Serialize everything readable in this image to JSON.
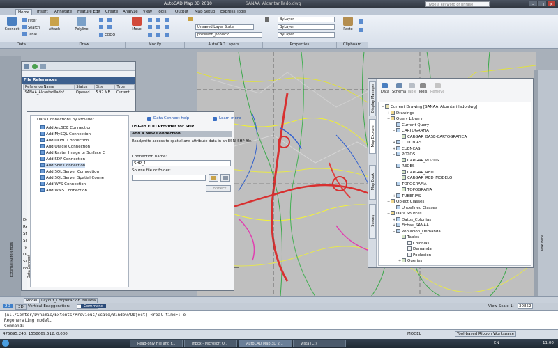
{
  "title_bar": {
    "app_title": "AutoCAD Map 3D 2010",
    "file_title": "SANAA_Alcantarillado.dwg",
    "search_placeholder": "Type a keyword or phrase",
    "min_glyph": "–",
    "max_glyph": "□",
    "close_glyph": "×"
  },
  "ribbon_tabs": [
    "Home",
    "Insert",
    "Annotate",
    "Feature Edit",
    "Create",
    "Analyze",
    "View",
    "Tools",
    "Output",
    "Map Setup",
    "Express Tools"
  ],
  "ribbon": {
    "panels": [
      "Data",
      "Draw",
      "Modify",
      "AutoCAD Layers",
      "Properties",
      "Clipboard"
    ],
    "connect": "Connect",
    "filter": "Filter",
    "search": "Search",
    "table": "Table",
    "attach": "Attach",
    "polyline": "Polyline",
    "cogo": "COGO",
    "move": "Move",
    "layer_state": "Unsaved Layer State",
    "layer_current": "prevision_poblacio",
    "bylayer": "ByLayer",
    "paste": "Paste"
  },
  "file_references": {
    "section_title": "File References",
    "columns": [
      "Reference Name",
      "Status",
      "Size",
      "Type"
    ],
    "rows": [
      {
        "name": "SANAA_Alcantarillado*",
        "status": "Opened",
        "size": "5.92 MB",
        "type": "Current"
      }
    ],
    "side_label": "External References",
    "side_label2": "Data Connect",
    "detail_lines": [
      "De",
      "Re",
      "St",
      "Siz",
      "Ty",
      "Da",
      "Sa",
      "Fo"
    ]
  },
  "data_connect": {
    "by_provider": "Data Connections by Provider",
    "providers": [
      "Add ArcSDE Connection",
      "Add MySQL Connection",
      "Add ODBC Connection",
      "Add Oracle Connection",
      "Add Raster Image or Surface C",
      "Add SDF Connection",
      "Add SHP Connection",
      "Add SQL Server Connection",
      "Add SQL Server Spatial Conne",
      "Add WFS Connection",
      "Add WMS Connection"
    ],
    "help_link": "Data Connect help",
    "learn_more": "Learn more",
    "provider_title": "OSGeo FDO Provider for SHP",
    "add_new_connection": "Add a New Connection",
    "description": "Read/write access to spatial and attribute data in an ESRI SHP file.",
    "connection_name_label": "Connection name:",
    "connection_name_value": "SHP_1",
    "source_label": "Source file or folder:",
    "connect_button": "Connect"
  },
  "display_manager": {
    "tabs": [
      "Display Manager",
      "Map Explorer",
      "Map Book",
      "Survey"
    ],
    "toolbar": [
      "Data",
      "Schema",
      "Table",
      "Tools",
      "Remove"
    ],
    "tree": [
      {
        "label": "Current Drawing [SANAA_Alcantarillado.dwg]",
        "level": 0,
        "toggle": "−"
      },
      {
        "label": "Drawings",
        "level": 1,
        "toggle": "+"
      },
      {
        "label": "Query Library",
        "level": 1,
        "toggle": "−"
      },
      {
        "label": "Current Query",
        "level": 2,
        "toggle": ""
      },
      {
        "label": "CARTOGRAFIA",
        "level": 2,
        "toggle": "−"
      },
      {
        "label": "CARGAR_BASE-CARTOGRAFICA",
        "level": 3,
        "toggle": ""
      },
      {
        "label": "COLONIAS",
        "level": 2,
        "toggle": "+"
      },
      {
        "label": "CUENCAS",
        "level": 2,
        "toggle": "+"
      },
      {
        "label": "POZOS",
        "level": 2,
        "toggle": "−"
      },
      {
        "label": "CARGAR_POZOS",
        "level": 3,
        "toggle": ""
      },
      {
        "label": "REDES",
        "level": 2,
        "toggle": "−"
      },
      {
        "label": "CARGAR_RED",
        "level": 3,
        "toggle": ""
      },
      {
        "label": "CARGAR_RED_MODELO",
        "level": 3,
        "toggle": ""
      },
      {
        "label": "TOPOGRAFIA",
        "level": 2,
        "toggle": "−"
      },
      {
        "label": "TOPOGRAFIA",
        "level": 3,
        "toggle": ""
      },
      {
        "label": "TUBERIAS",
        "level": 2,
        "toggle": "+"
      },
      {
        "label": "Object Classes",
        "level": 1,
        "toggle": "−"
      },
      {
        "label": "Undefined Classes",
        "level": 2,
        "toggle": ""
      },
      {
        "label": "Data Sources",
        "level": 1,
        "toggle": "−"
      },
      {
        "label": "Datos_Colonias",
        "level": 2,
        "toggle": "+"
      },
      {
        "label": "Fichas_SANAA",
        "level": 2,
        "toggle": "+"
      },
      {
        "label": "Poblacion_Demanda",
        "level": 2,
        "toggle": "−"
      },
      {
        "label": "Tables",
        "level": 3,
        "toggle": "−"
      },
      {
        "label": "Colonias",
        "level": 4,
        "toggle": ""
      },
      {
        "label": "Demanda",
        "level": 4,
        "toggle": ""
      },
      {
        "label": "Poblacion",
        "level": 4,
        "toggle": ""
      },
      {
        "label": "Queries",
        "level": 3,
        "toggle": "+"
      }
    ],
    "task_pane_label": "Task Pane"
  },
  "status_top": {
    "model_tabs": [
      "Model",
      "Layout_Cooperacion Italiana"
    ],
    "toggle_2d": "2D",
    "toggle_3d": "3D",
    "vertical_exaggeration": "Vertical Exaggeration:",
    "command_label": "Command",
    "view_scale": "View Scale 1:",
    "scale_value": "30852"
  },
  "command_lines": [
    "[All/Center/Dynamic/Extents/Previous/Scale/Window/Object] <real time>: e",
    "Regenerating model.",
    "Command:"
  ],
  "status_bottom": {
    "coordinates": "475695.240, 1558669.512, 0.000",
    "model": "MODEL",
    "ribbon_state": "Tool-based Ribbon Workspace"
  },
  "taskbar": {
    "items": [
      "Read-only File and F...",
      "Inbox - Microsoft O...",
      "AutoCAD Map 3D 2...",
      "Vista (C:)"
    ],
    "lang": "EN",
    "clock": "11:00"
  }
}
